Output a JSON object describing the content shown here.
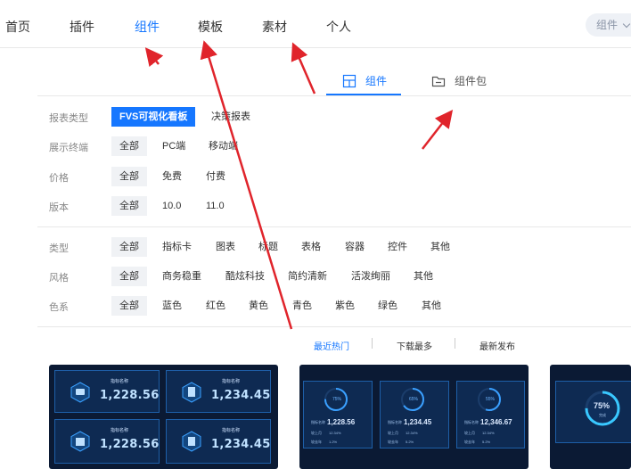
{
  "nav": {
    "items": [
      {
        "label": "首页",
        "name": "nav-home",
        "active": false
      },
      {
        "label": "插件",
        "name": "nav-plugins",
        "active": false
      },
      {
        "label": "组件",
        "name": "nav-components",
        "active": true
      },
      {
        "label": "模板",
        "name": "nav-templates",
        "active": false
      },
      {
        "label": "素材",
        "name": "nav-materials",
        "active": false
      },
      {
        "label": "个人",
        "name": "nav-personal",
        "active": false
      }
    ],
    "search_select": "组件"
  },
  "content_tabs": [
    {
      "label": "组件",
      "icon": "layout-grid-icon",
      "active": true
    },
    {
      "label": "组件包",
      "icon": "folder-icon",
      "active": false
    }
  ],
  "filters": {
    "report_type": {
      "label": "报表类型",
      "options": [
        "FVS可视化看板",
        "决策报表"
      ]
    },
    "display_terminal": {
      "label": "展示终端",
      "options": [
        "全部",
        "PC端",
        "移动端"
      ]
    },
    "price": {
      "label": "价格",
      "options": [
        "全部",
        "免费",
        "付费"
      ]
    },
    "version": {
      "label": "版本",
      "options": [
        "全部",
        "10.0",
        "11.0"
      ]
    },
    "type": {
      "label": "类型",
      "options": [
        "全部",
        "指标卡",
        "图表",
        "标题",
        "表格",
        "容器",
        "控件",
        "其他"
      ]
    },
    "style": {
      "label": "风格",
      "options": [
        "全部",
        "商务稳重",
        "酷炫科技",
        "简约清新",
        "活泼绚丽",
        "其他"
      ]
    },
    "color": {
      "label": "色系",
      "options": [
        "全部",
        "蓝色",
        "红色",
        "黄色",
        "青色",
        "紫色",
        "绿色",
        "其他"
      ]
    }
  },
  "sort": {
    "options": [
      "最近热门",
      "下载最多",
      "最新发布"
    ],
    "active": "最近热门"
  },
  "cards": {
    "card1": {
      "metric_name": "指标名称",
      "values": [
        "1,228.56",
        "1,234.45",
        "1,228.56",
        "1,234.45"
      ]
    },
    "card2": {
      "rings": [
        "75%",
        "65%",
        "55%"
      ],
      "metric_name": "指标名称",
      "values": [
        "1,228.56",
        "1,234.45",
        "12,346.67"
      ],
      "row1_label": "较上月",
      "row1_values": [
        "12.34%",
        "12.34%",
        "12.34%"
      ],
      "row2_label": "较去年",
      "row2_values": [
        "1.2%",
        "5.2%",
        "5.2%"
      ]
    },
    "card3": {
      "ring": "75%",
      "ring_sub": "完成"
    }
  },
  "colors": {
    "accent": "#1677ff",
    "card_bg": "#0b1a34",
    "arrow": "#e0242b"
  }
}
